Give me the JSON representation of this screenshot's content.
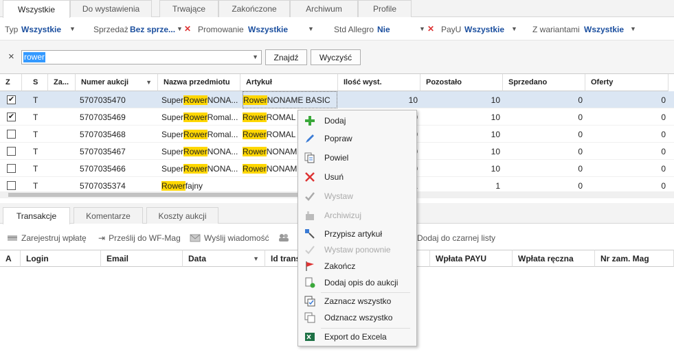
{
  "tabs": [
    "Wszystkie",
    "Do wystawienia",
    "Trwające",
    "Zakończone",
    "Archiwum",
    "Profile"
  ],
  "filters": {
    "typ_label": "Typ",
    "typ_value": "Wszystkie",
    "sprzedaz_label": "Sprzedaż",
    "sprzedaz_value": "Bez sprze...",
    "promowanie_label": "Promowanie",
    "promowanie_value": "Wszystkie",
    "std_label": "Std Allegro",
    "std_value": "Nie",
    "payu_label": "PayU",
    "payu_value": "Wszystkie",
    "warianty_label": "Z wariantami",
    "warianty_value": "Wszystkie"
  },
  "search": {
    "value": "rower",
    "find_label": "Znajdź",
    "clear_label": "Wyczyść",
    "clear_icon": "×"
  },
  "grid": {
    "headers": [
      "Z",
      "S",
      "Za...",
      "Numer aukcji",
      "Nazwa przedmiotu",
      "Artykuł",
      "Ilość wyst.",
      "Pozostało",
      "Sprzedano",
      "Oferty"
    ],
    "rows": [
      {
        "checked": true,
        "s": "T",
        "num": "5707035470",
        "name_pre": "Super ",
        "name_hl": "Rower",
        "name_post": " NONA...",
        "art_hl": "Rower",
        "art_post": " NONAME BASIC",
        "ilosc": "10",
        "pozostalo": "10",
        "sprzedano": "0",
        "oferty": "0"
      },
      {
        "checked": true,
        "s": "T",
        "num": "5707035469",
        "name_pre": "Super ",
        "name_hl": "Rower",
        "name_post": " Romal...",
        "art_hl": "Rower",
        "art_post": " ROMAL",
        "ilosc": "0",
        "pozostalo": "10",
        "sprzedano": "0",
        "oferty": "0"
      },
      {
        "checked": false,
        "s": "T",
        "num": "5707035468",
        "name_pre": "Super ",
        "name_hl": "Rower",
        "name_post": " Romal...",
        "art_hl": "Rower",
        "art_post": " ROMAL",
        "ilosc": "0",
        "pozostalo": "10",
        "sprzedano": "0",
        "oferty": "0"
      },
      {
        "checked": false,
        "s": "T",
        "num": "5707035467",
        "name_pre": "Super ",
        "name_hl": "Rower",
        "name_post": " NONA...",
        "art_hl": "Rower",
        "art_post": " NONAM",
        "ilosc": "0",
        "pozostalo": "10",
        "sprzedano": "0",
        "oferty": "0"
      },
      {
        "checked": false,
        "s": "T",
        "num": "5707035466",
        "name_pre": "Super ",
        "name_hl": "Rower",
        "name_post": " NONA...",
        "art_hl": "Rower",
        "art_post": " NONAM",
        "ilosc": "0",
        "pozostalo": "10",
        "sprzedano": "0",
        "oferty": "0"
      },
      {
        "checked": false,
        "s": "T",
        "num": "5707035374",
        "name_pre": "",
        "name_hl": "Rower",
        "name_post": " fajny",
        "art_hl": "",
        "art_post": "",
        "ilosc": "1",
        "pozostalo": "1",
        "sprzedano": "0",
        "oferty": "0"
      }
    ]
  },
  "bottom_tabs": [
    "Transakcje",
    "Komentarze",
    "Koszty aukcji"
  ],
  "bottom_toolbar": [
    "Zarejestruj wpłatę",
    "Prześlij do WF-Mag",
    "Wyślij wiadomość",
    "Dodaj do czarnej listy"
  ],
  "bottom_headers": [
    "A",
    "Login",
    "Email",
    "Data",
    "Id trans",
    "Wpłata PAYU",
    "Wpłata ręczna",
    "Nr zam. Mag"
  ],
  "context_menu": [
    {
      "label": "Dodaj",
      "icon": "plus-icon",
      "disabled": false
    },
    {
      "label": "Popraw",
      "icon": "pencil-icon",
      "disabled": false
    },
    {
      "label": "Powiel",
      "icon": "duplicate-icon",
      "disabled": false
    },
    {
      "label": "Usuń",
      "icon": "delete-icon",
      "disabled": false
    },
    {
      "label": "Wystaw",
      "icon": "check-icon",
      "disabled": true
    },
    {
      "label": "Archiwizuj",
      "icon": "archive-icon",
      "disabled": true
    },
    {
      "label": "Przypisz artykuł",
      "icon": "assign-icon",
      "disabled": false
    },
    {
      "label": "Wystaw ponownie",
      "icon": "recheck-icon",
      "disabled": true
    },
    {
      "label": "Zakończ",
      "icon": "flag-icon",
      "disabled": false
    },
    {
      "label": "Dodaj opis do aukcji",
      "icon": "add-description-icon",
      "disabled": false
    },
    {
      "label": "Zaznacz wszystko",
      "icon": "select-all-icon",
      "disabled": false
    },
    {
      "label": "Odznacz wszystko",
      "icon": "deselect-all-icon",
      "disabled": false
    },
    {
      "label": "Export do Excela",
      "icon": "excel-icon",
      "disabled": false
    }
  ],
  "colors": {
    "accent": "#1a4e9e",
    "highlight": "#ffd700",
    "selected_row": "#dbe6f3",
    "delete": "#d33"
  }
}
